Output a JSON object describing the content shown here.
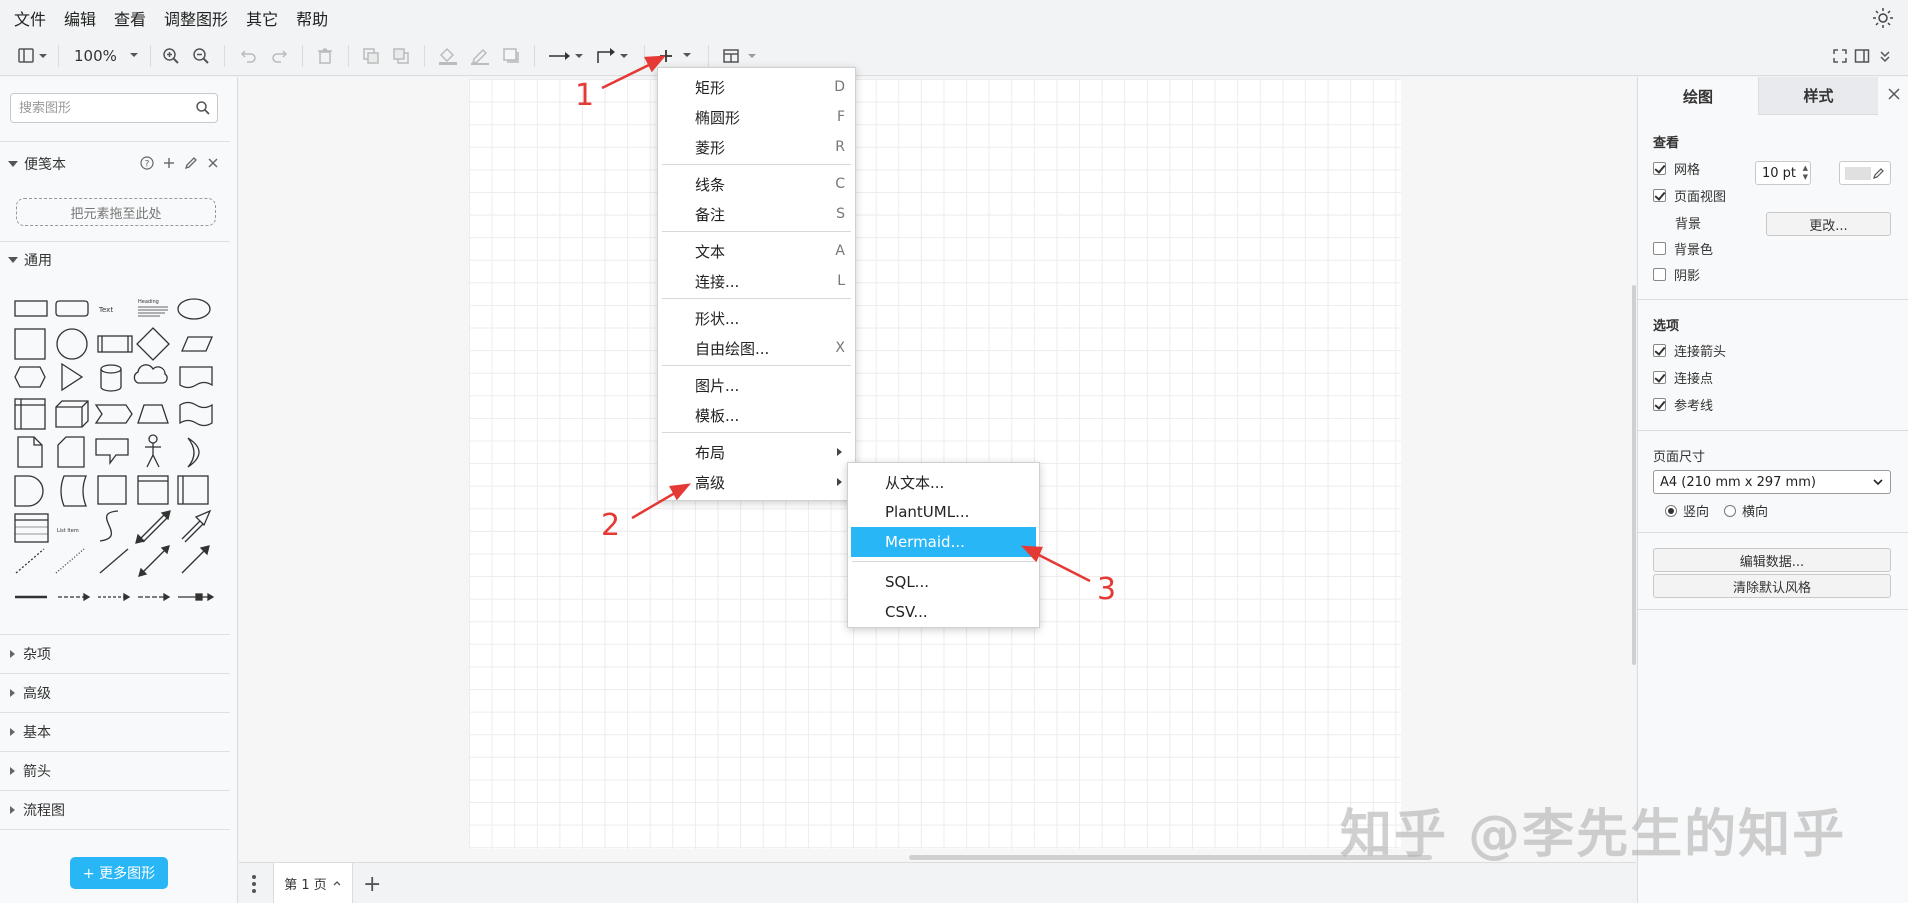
{
  "menubar": [
    "文件",
    "编辑",
    "查看",
    "调整图形",
    "其它",
    "帮助"
  ],
  "toolbar": {
    "zoom": "100%"
  },
  "sidebar": {
    "search_placeholder": "搜索图形",
    "scratchpad_title": "便笺本",
    "dropzone_text": "把元素拖至此处",
    "general_title": "通用",
    "shape_labels": {
      "text": "Text",
      "heading": "Heading",
      "list_item": "List Item"
    },
    "collapsed_sections": [
      "杂项",
      "高级",
      "基本",
      "箭头",
      "流程图"
    ],
    "more_shapes_label": "+ 更多图形"
  },
  "insert_menu": {
    "items": [
      {
        "label": "矩形",
        "key": "D"
      },
      {
        "label": "椭圆形",
        "key": "F"
      },
      {
        "label": "菱形",
        "key": "R"
      },
      {
        "label": "线条",
        "key": "C"
      },
      {
        "label": "备注",
        "key": "S"
      },
      {
        "label": "文本",
        "key": "A"
      },
      {
        "label": "连接...",
        "key": "L"
      },
      {
        "label": "形状...",
        "key": ""
      },
      {
        "label": "自由绘图...",
        "key": "X"
      },
      {
        "label": "图片...",
        "key": ""
      },
      {
        "label": "模板...",
        "key": ""
      },
      {
        "label": "布局",
        "key": ""
      },
      {
        "label": "高级",
        "key": ""
      }
    ]
  },
  "advanced_submenu": {
    "items": [
      "从文本...",
      "PlantUML...",
      "Mermaid...",
      "SQL...",
      "CSV..."
    ],
    "highlighted": "Mermaid..."
  },
  "annotations": [
    "1",
    "2",
    "3"
  ],
  "annotation_color": "#e53935",
  "pagebar": {
    "tab_label": "第 1 页",
    "add_label": "+"
  },
  "right_panel": {
    "tab_diagram": "绘图",
    "tab_style": "样式",
    "view_title": "查看",
    "grid_label": "网格",
    "grid_size": "10 pt",
    "page_view_label": "页面视图",
    "background_label": "背景",
    "change_button": "更改...",
    "bg_color_label": "背景色",
    "shadow_label": "阴影",
    "options_title": "选项",
    "connection_arrows_label": "连接箭头",
    "connection_points_label": "连接点",
    "guides_label": "参考线",
    "page_size_title": "页面尺寸",
    "page_size_value": "A4 (210 mm x 297 mm)",
    "portrait_label": "竖向",
    "landscape_label": "横向",
    "edit_data_button": "编辑数据...",
    "clear_style_button": "清除默认风格"
  },
  "watermark": "知乎 @李先生的知乎",
  "accent_color": "#29b6f6"
}
